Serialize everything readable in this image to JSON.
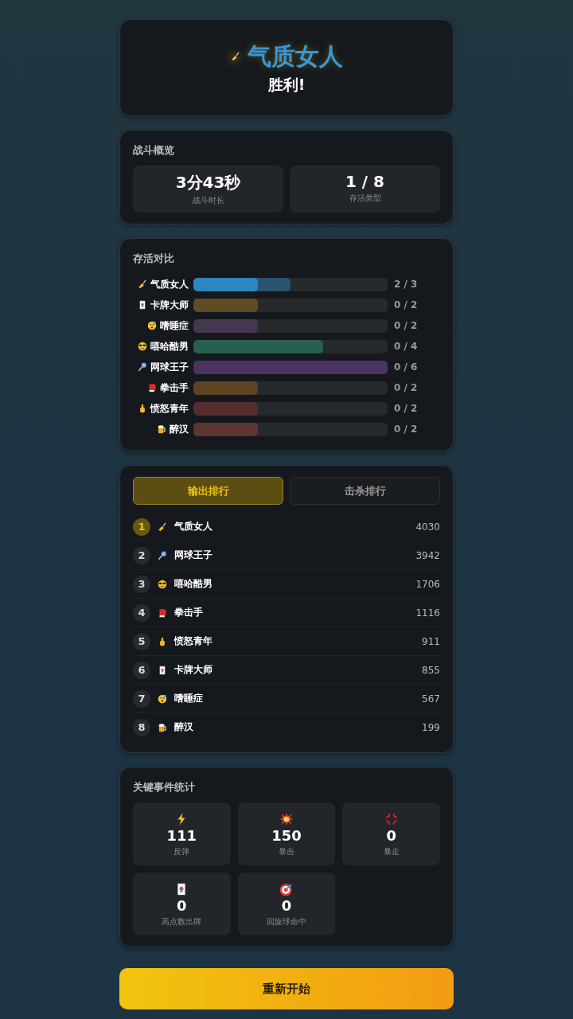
{
  "hero": {
    "winner": {
      "name": "气质女人",
      "kind": "brush"
    },
    "result": "胜利!"
  },
  "overview": {
    "title": "战斗概览",
    "stats": [
      {
        "value": "3分43秒",
        "label": "战斗时长"
      },
      {
        "value": "1 / 8",
        "label": "存活类型"
      }
    ]
  },
  "survival": {
    "title": "存活对比",
    "rows": [
      {
        "kind": "brush",
        "name": "气质女人",
        "color": "#2e86c1",
        "level": 0.5,
        "alive": {
          "level": 0.333
        },
        "count": "2 / 3"
      },
      {
        "kind": "card",
        "name": "卡牌大师",
        "color": "#5f4b24",
        "level": 0.333,
        "count": "0 / 2"
      },
      {
        "kind": "sleepy",
        "name": "嗜睡症",
        "color": "#45374f",
        "level": 0.333,
        "count": "0 / 2"
      },
      {
        "kind": "cool",
        "name": "嘻哈酷男",
        "color": "#28604f",
        "level": 0.667,
        "count": "0 / 4"
      },
      {
        "kind": "tennis",
        "name": "网球王子",
        "color": "#4a3360",
        "level": 1,
        "count": "0 / 6"
      },
      {
        "kind": "boxing",
        "name": "拳击手",
        "color": "#5f4424",
        "level": 0.333,
        "count": "0 / 2"
      },
      {
        "kind": "finger",
        "name": "愤怒青年",
        "color": "#552d2c",
        "level": 0.333,
        "count": "0 / 2"
      },
      {
        "kind": "beer",
        "name": "醉汉",
        "color": "#5c3630",
        "level": 0.333,
        "count": "0 / 2"
      }
    ]
  },
  "ranking": {
    "tabs": [
      {
        "label": "输出排行",
        "selected": true
      },
      {
        "label": "击杀排行",
        "selected": false
      }
    ],
    "rows": [
      {
        "rank": "1",
        "kind": "brush",
        "name": "气质女人",
        "value": "4030",
        "selected": true
      },
      {
        "rank": "2",
        "kind": "tennis",
        "name": "网球王子",
        "value": "3942",
        "selected": false
      },
      {
        "rank": "3",
        "kind": "cool",
        "name": "嘻哈酷男",
        "value": "1706",
        "selected": false
      },
      {
        "rank": "4",
        "kind": "boxing",
        "name": "拳击手",
        "value": "1116",
        "selected": false
      },
      {
        "rank": "5",
        "kind": "finger",
        "name": "愤怒青年",
        "value": "911",
        "selected": false
      },
      {
        "rank": "6",
        "kind": "card",
        "name": "卡牌大师",
        "value": "855",
        "selected": false
      },
      {
        "rank": "7",
        "kind": "sleepy",
        "name": "嗜睡症",
        "value": "567",
        "selected": false
      },
      {
        "rank": "8",
        "kind": "beer",
        "name": "醉汉",
        "value": "199",
        "selected": false
      }
    ]
  },
  "events": {
    "title": "关键事件统计",
    "items": [
      {
        "kind": "bolt",
        "value": "111",
        "label": "反弹"
      },
      {
        "kind": "burst",
        "value": "150",
        "label": "暴击"
      },
      {
        "kind": "anger",
        "value": "0",
        "label": "暴走"
      },
      {
        "kind": "card",
        "value": "0",
        "label": "高点数出牌"
      },
      {
        "kind": "target",
        "value": "0",
        "label": "回旋球命中"
      }
    ]
  },
  "actions": {
    "restart": "重新开始"
  }
}
